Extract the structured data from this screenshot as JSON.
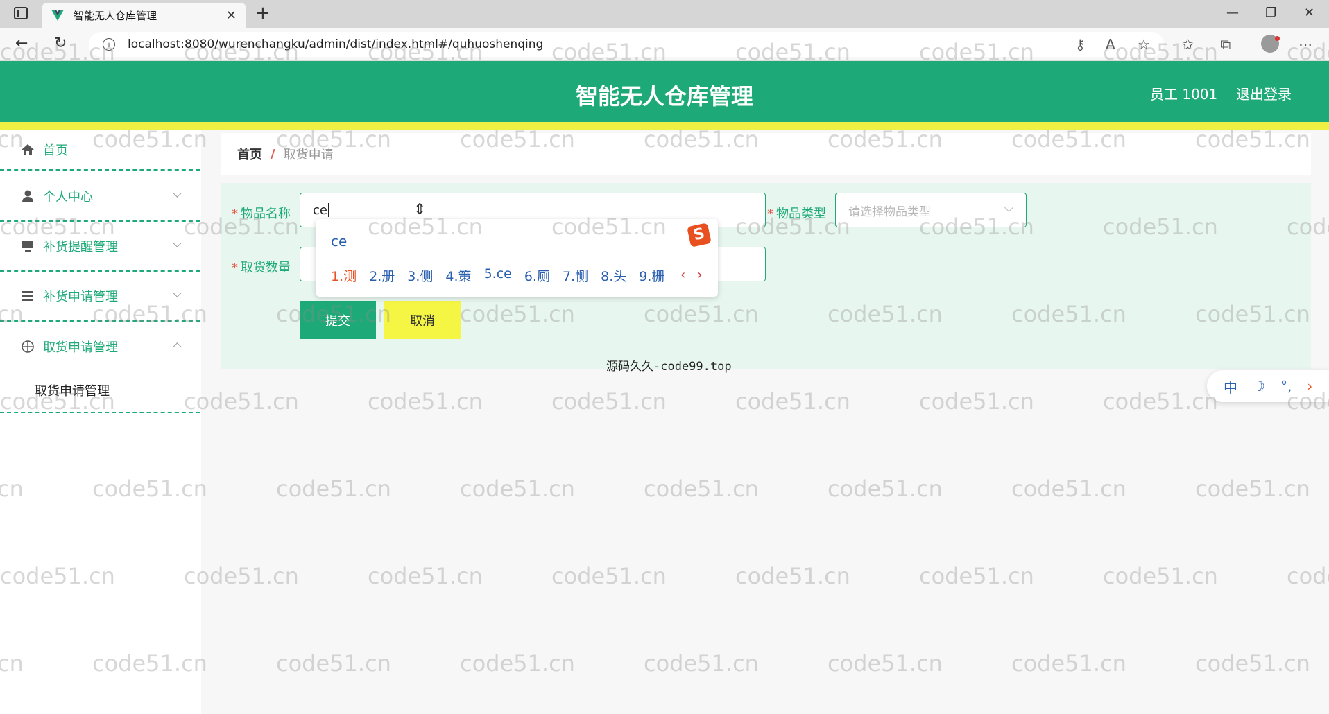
{
  "browser": {
    "tab_title": "智能无人仓库管理",
    "url": "localhost:8080/wurenchangku/admin/dist/index.html#/quhuoshenqing"
  },
  "header": {
    "title": "智能无人仓库管理",
    "user": "员工 1001",
    "logout": "退出登录"
  },
  "sidebar": {
    "items": [
      {
        "label": "首页",
        "icon": "home-icon"
      },
      {
        "label": "个人中心",
        "icon": "user-icon"
      },
      {
        "label": "补货提醒管理",
        "icon": "monitor-icon"
      },
      {
        "label": "补货申请管理",
        "icon": "list-icon"
      },
      {
        "label": "取货申请管理",
        "icon": "compass-icon"
      }
    ],
    "sub_item": "取货申请管理"
  },
  "breadcrumb": {
    "home": "首页",
    "separator": "/",
    "current": "取货申请"
  },
  "form": {
    "item_name_label": "物品名称",
    "item_name_value": "ce",
    "item_type_label": "物品类型",
    "item_type_placeholder": "请选择物品类型",
    "quantity_label": "取货数量",
    "submit": "提交",
    "cancel": "取消"
  },
  "footer": "源码久久-code99.top",
  "ime": {
    "input": "ce",
    "candidates": [
      "1.测",
      "2.册",
      "3.侧",
      "4.策",
      "5.ce",
      "6.厕",
      "7.恻",
      "8.头",
      "9.栅"
    ],
    "prev": "‹",
    "next": "›",
    "toolbar": [
      "中",
      "☽",
      "°,",
      "›"
    ]
  },
  "watermark": "code51.cn",
  "colors": {
    "accent": "#1eaa78",
    "header_stripe": "#f0f044",
    "cancel_button": "#f5f544",
    "required": "#e05a4a"
  }
}
